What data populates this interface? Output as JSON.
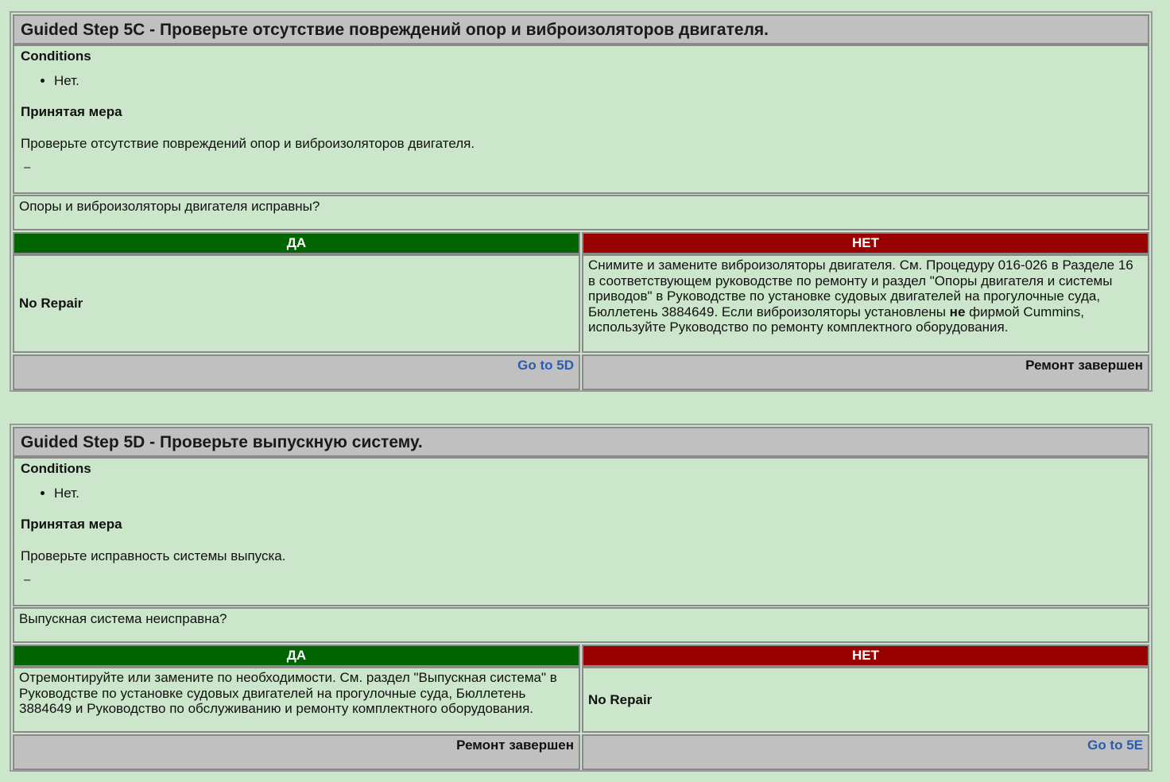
{
  "steps": [
    {
      "title": "Guided Step 5C - Проверьте отсутствие повреждений опор и виброизоляторов двигателя.",
      "conditions_label": "Conditions",
      "conditions_item": "Нет.",
      "action_label": "Принятая мера",
      "action_text": "Проверьте отсутствие повреждений опор и виброизоляторов двигателя.",
      "dash": "–",
      "question": "Опоры и виброизоляторы двигателя исправны?",
      "yes_header": "ДА",
      "no_header": "НЕТ",
      "yes_body": "No Repair",
      "no_body_part1": "Снимите и замените виброизоляторы двигателя. См. Процедуру 016-026 в Разделе 16 в соответствующем руководстве по ремонту и раздел \"Опоры двигателя и системы приводов\" в Руководстве по установке судовых двигателей на прогулочные суда, Бюллетень 3884649. Если виброизоляторы установлены ",
      "no_body_bold": "не",
      "no_body_part2": " фирмой Cummins, используйте Руководство по ремонту комплектного оборудования.",
      "yes_footer": "Go to 5D",
      "no_footer": "Ремонт завершен"
    },
    {
      "title": "Guided Step 5D - Проверьте выпускную систему.",
      "conditions_label": "Conditions",
      "conditions_item": "Нет.",
      "action_label": "Принятая мера",
      "action_text": "Проверьте исправность системы выпуска.",
      "dash": "–",
      "question": "Выпускная система неисправна?",
      "yes_header": "ДА",
      "no_header": "НЕТ",
      "yes_body": "Отремонтируйте или замените по необходимости. См. раздел \"Выпускная система\" в Руководстве по установке судовых двигателей на прогулочные суда, Бюллетень 3884649 и Руководство по обслуживанию и ремонту комплектного оборудования.",
      "no_body": "No Repair",
      "yes_footer": "Ремонт завершен",
      "no_footer": "Go to 5E"
    }
  ]
}
